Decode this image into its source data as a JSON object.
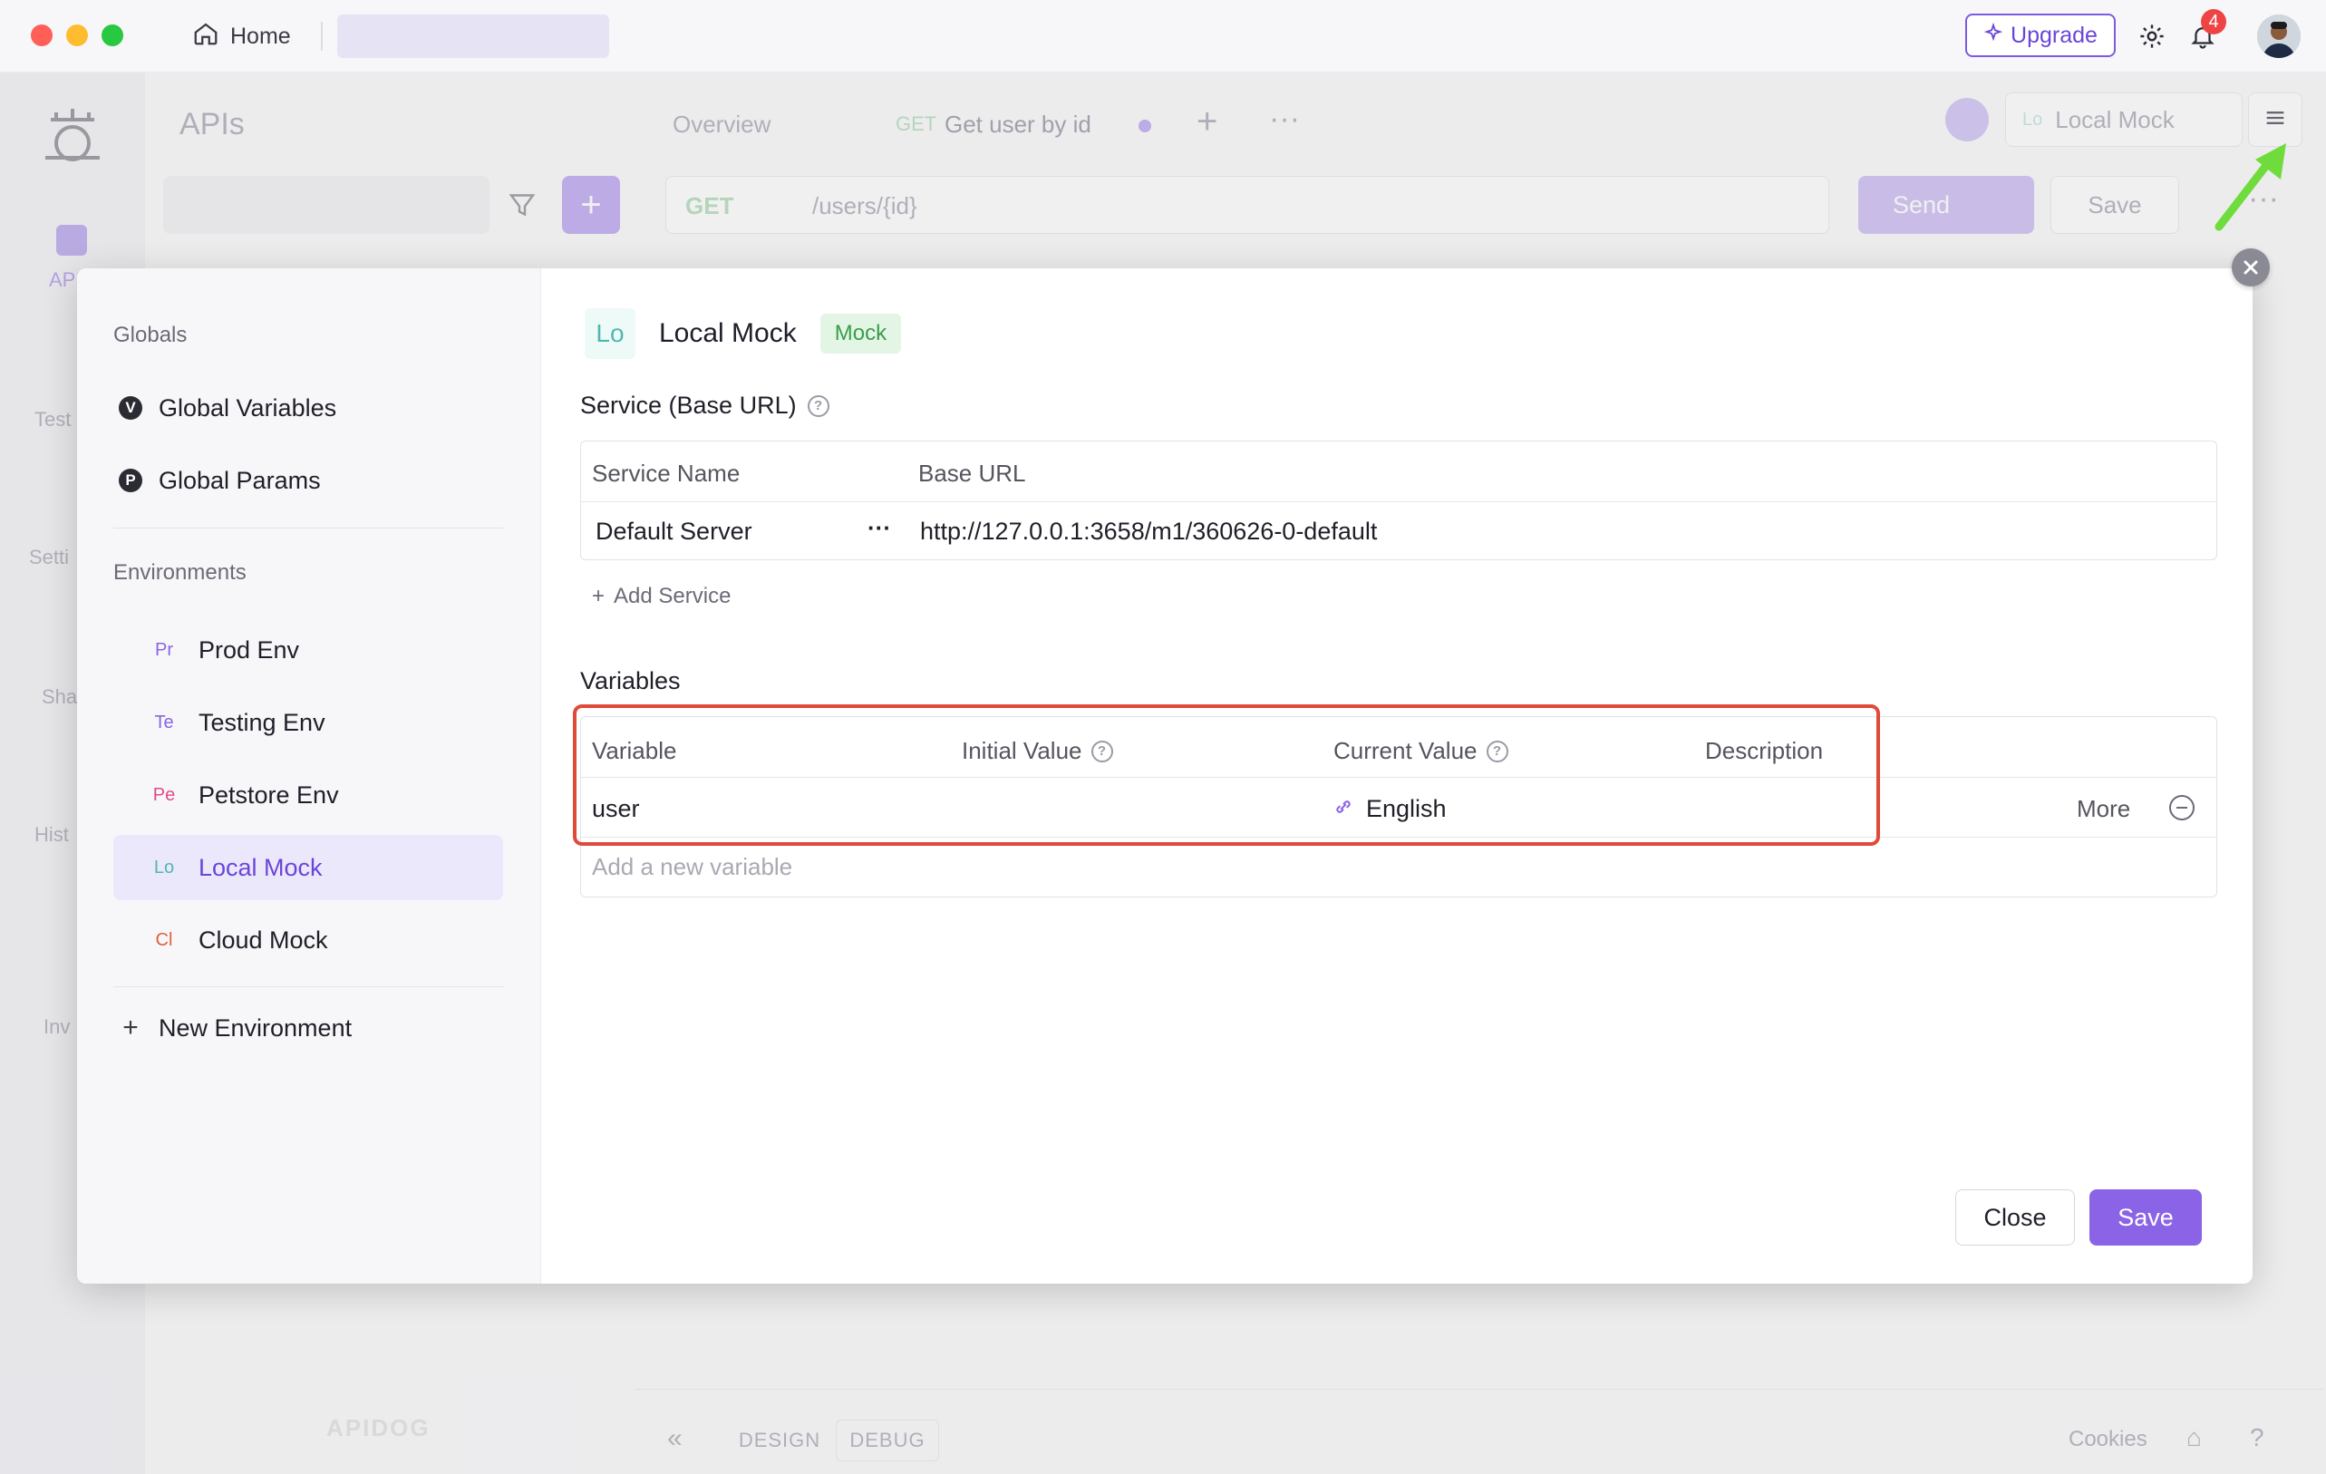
{
  "titlebar": {
    "home_label": "Home",
    "upgrade_label": "Upgrade",
    "notification_count": "4"
  },
  "background": {
    "section_title": "APIs",
    "tabs": {
      "overview": "Overview",
      "method": "GET",
      "request_name": "Get user by id"
    },
    "env_selector_badge": "Lo",
    "env_selector": "Local Mock",
    "request": {
      "method": "GET",
      "path": "/users/{id}"
    },
    "send_label": "Send",
    "save_label": "Save",
    "rail_items": [
      "API",
      "Test",
      "Setti",
      "Sha",
      "Hist",
      "Inv"
    ],
    "bottom_tabs": [
      "DESIGN",
      "DEBUG"
    ],
    "cookies_label": "Cookies",
    "brand_mark": "APIDOG"
  },
  "modal": {
    "sidebar": {
      "globals_heading": "Globals",
      "global_items": [
        {
          "badge": "V",
          "label": "Global Variables"
        },
        {
          "badge": "P",
          "label": "Global Params"
        }
      ],
      "environments_heading": "Environments",
      "environments": [
        {
          "badge": "Pr",
          "label": "Prod Env",
          "badge_color": "#8b63e6"
        },
        {
          "badge": "Te",
          "label": "Testing Env",
          "badge_color": "#8b63e6"
        },
        {
          "badge": "Pe",
          "label": "Petstore Env",
          "badge_color": "#e04a8a"
        },
        {
          "badge": "Lo",
          "label": "Local Mock",
          "badge_color": "#4fb8b0"
        },
        {
          "badge": "Cl",
          "label": "Cloud Mock",
          "badge_color": "#e0603a"
        }
      ],
      "new_environment": "New Environment"
    },
    "header": {
      "badge": "Lo",
      "title": "Local Mock",
      "tag": "Mock"
    },
    "service": {
      "label": "Service (Base URL)",
      "columns": [
        "Service Name",
        "Base URL"
      ],
      "rows": [
        {
          "name": "Default Server",
          "url": "http://127.0.0.1:3658/m1/360626-0-default"
        }
      ],
      "add_label": "Add Service"
    },
    "variables": {
      "label": "Variables",
      "columns": [
        "Variable",
        "Initial Value",
        "Current Value",
        "Description"
      ],
      "rows": [
        {
          "variable": "user",
          "initial": "",
          "current": "English",
          "description": "",
          "more": "More"
        }
      ],
      "placeholder": "Add a new variable"
    },
    "footer": {
      "close_label": "Close",
      "save_label": "Save"
    }
  },
  "colors": {
    "accent": "#8b63e6",
    "highlight_box": "#e04a3a",
    "annotation_arrow": "#6fdc3c"
  }
}
